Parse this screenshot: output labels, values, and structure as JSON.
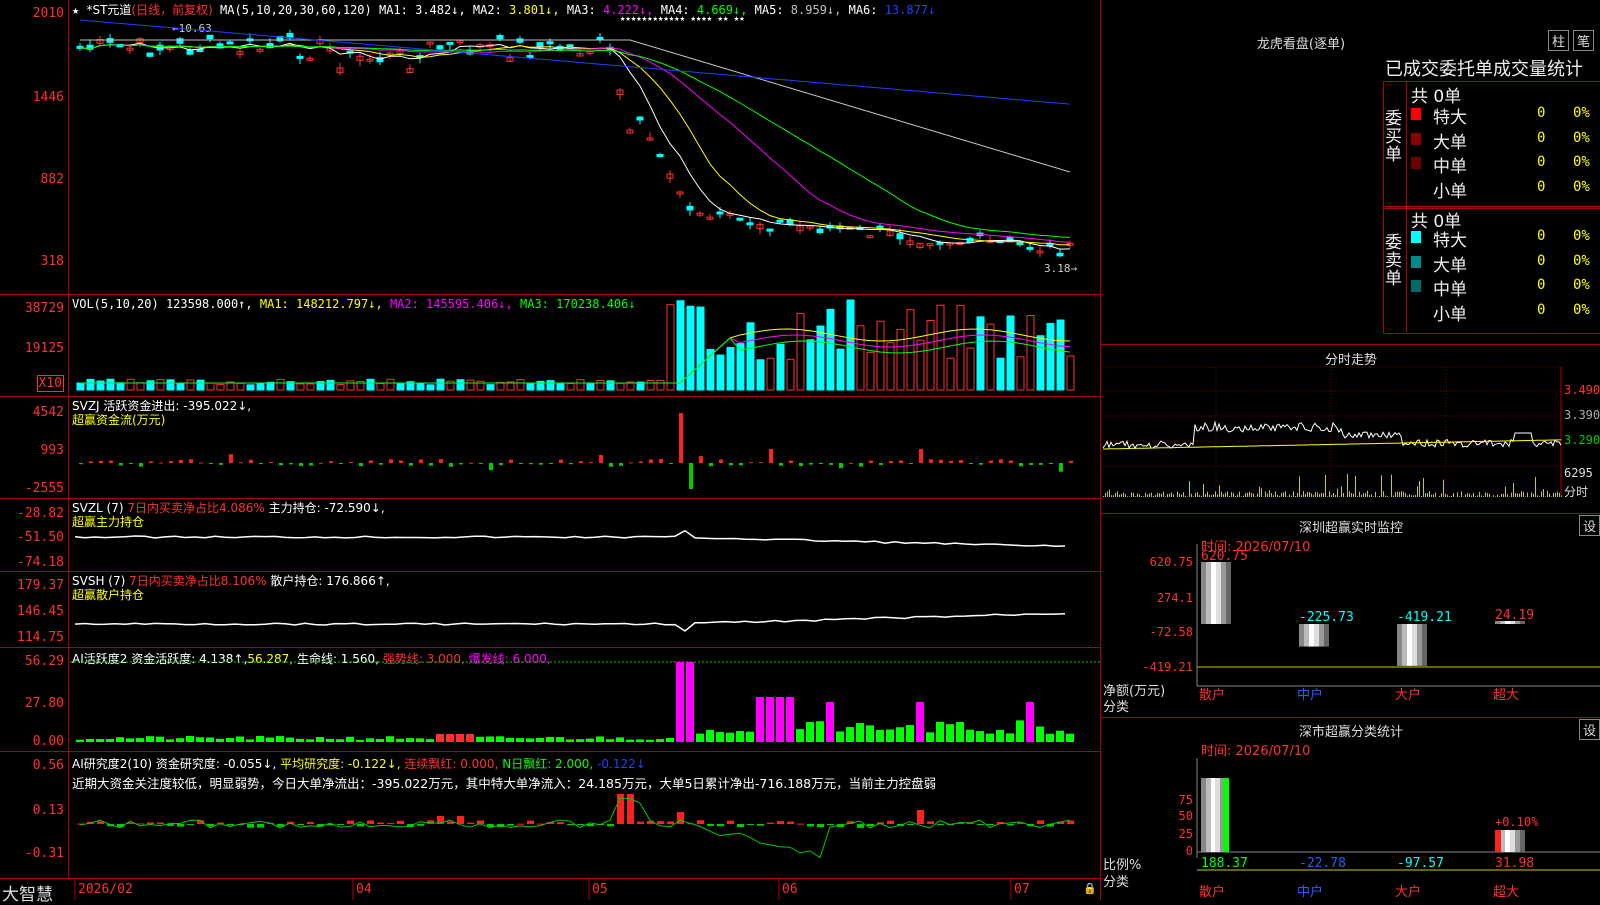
{
  "main": {
    "star_label": "★",
    "stock_name": "*ST元道",
    "period_label": "(日线，前复权)",
    "ma_label": "MA(5,10,20,30,60,120)",
    "ma_values": [
      {
        "name": "MA1:",
        "value": "3.482↓,",
        "color": "#ffffff"
      },
      {
        "name": "MA2:",
        "value": "3.801↓,",
        "color": "#ffff00"
      },
      {
        "name": "MA3:",
        "value": "4.222↓,",
        "color": "#ff00ff"
      },
      {
        "name": "MA4:",
        "value": "4.669↓,",
        "color": "#00ff00"
      },
      {
        "name": "MA5:",
        "value": "8.959↓,",
        "color": "#c0c0c0"
      },
      {
        "name": "MA6:",
        "value": "13.877↓",
        "color": "#2040ff"
      }
    ],
    "yticks": [
      "2010",
      "1446",
      "882",
      "318"
    ],
    "high_label": "←10.63",
    "low_label": "3.18→",
    "star_marks": "★★★★★★★★★★★★    ★★★★  ★★   ★★"
  },
  "vol": {
    "title": "VOL(5,10,20)",
    "value": "123598.000↑,",
    "ma1": "MA1: 148212.797↓,",
    "ma2": "MA2: 145595.406↓,",
    "ma3": "MA3: 170238.406↓",
    "yticks": [
      "38729",
      "19125"
    ],
    "scale_label": "X10"
  },
  "svzj": {
    "title": "SVZJ",
    "line1": "活跃资金进出: -395.022↓,",
    "line2": "超赢资金流(万元)",
    "yticks": [
      "4542",
      "993",
      "-2555"
    ]
  },
  "svzl": {
    "title": "SVZL (7)",
    "ratio": "7日内买卖净占比4.086%",
    "main": "主力持仓: -72.590↓,",
    "line2": "超赢主力持仓",
    "yticks": [
      "-28.82",
      "-51.50",
      "-74.18"
    ]
  },
  "svsh": {
    "title": "SVSH (7)",
    "ratio": "7日内买卖净占比8.106%",
    "main": "散户持仓: 176.866↑,",
    "line2": "超赢散户持仓",
    "yticks": [
      "179.37",
      "146.45",
      "114.75"
    ]
  },
  "ai1": {
    "title": "AI活跃度2",
    "v1": "资金活跃度: 4.138↑,",
    "v2": "56.287,",
    "v3": "生命线: 1.560,",
    "v4": "强势线: 3.000,",
    "v5": "爆发线: 6.000,",
    "yticks": [
      "56.29",
      "27.80",
      "0.00"
    ]
  },
  "ai2": {
    "title": "AI研究度2(10)",
    "v1": "资金研究度: -0.055↓,",
    "v2": "平均研究度: -0.122↓,",
    "v3": "连续飘红: 0.000,",
    "v4": "N日飘红: 2.000,",
    "v5": "-0.122↓",
    "summary": "近期大资金关注度较低，明显弱势，今日大单净流出：-395.022万元，其中特大单净流入：24.185万元，大单5日累计净出-716.188万元，当前主力控盘弱",
    "yticks": [
      "0.56",
      "0.13",
      "-0.31"
    ]
  },
  "xaxis": {
    "brand": "大智慧",
    "labels": [
      "2026/02",
      "04",
      "05",
      "06",
      "07"
    ]
  },
  "right": {
    "lhb": {
      "title": "龙虎看盘(逐单)",
      "btn1": "柱",
      "btn2": "笔",
      "subtitle": "已成交委托单成交量统计",
      "buy_group": "委买单",
      "sell_group": "委卖单",
      "buy_total": "共 0单",
      "sell_total": "共 0单",
      "buy_rows": [
        {
          "label": "特大",
          "count": "0",
          "pct": "0%",
          "color": "#ff0000"
        },
        {
          "label": "大单",
          "count": "0",
          "pct": "0%",
          "color": "#8b0000"
        },
        {
          "label": "中单",
          "count": "0",
          "pct": "0%",
          "color": "#6a0000"
        },
        {
          "label": "小单",
          "count": "0",
          "pct": "0%",
          "color": ""
        }
      ],
      "sell_rows": [
        {
          "label": "特大",
          "count": "0",
          "pct": "0%",
          "color": "#00ffff"
        },
        {
          "label": "大单",
          "count": "0",
          "pct": "0%",
          "color": "#008b8b"
        },
        {
          "label": "中单",
          "count": "0",
          "pct": "0%",
          "color": "#006a6a"
        },
        {
          "label": "小单",
          "count": "0",
          "pct": "0%",
          "color": ""
        }
      ]
    },
    "intraday": {
      "title": "分时走势",
      "yticks": [
        "3.490",
        "3.390",
        "3.290"
      ],
      "vol_tick": "6295",
      "vol_label": "分时"
    },
    "monitor": {
      "title": "深圳超赢实时监控",
      "btn": "设",
      "time": "时间: 2026/07/10",
      "yticks": [
        "620.75",
        "274.1",
        "-72.58",
        "-419.21"
      ],
      "ylabel": "净额(万元)",
      "xlabel": "分类",
      "categories": [
        "散户",
        "中户",
        "大户",
        "超大"
      ],
      "values": [
        "620.75",
        "-225.73",
        "-419.21",
        "24.19"
      ]
    },
    "classify": {
      "title": "深市超赢分类统计",
      "btn": "设",
      "time": "时间: 2026/07/10",
      "yticks": [
        "75",
        "50",
        "25",
        "0"
      ],
      "ylabel": "比例%",
      "xlabel": "分类",
      "categories": [
        "散户",
        "中户",
        "大户",
        "超大"
      ],
      "values": [
        "188.37",
        "-22.78",
        "-97.57",
        "31.98"
      ],
      "bar_label": "+0.10%"
    }
  },
  "chart_data": [
    {
      "type": "candlestick",
      "title": "*ST元道(日线，前复权)",
      "x_labels": [
        "2026/02",
        "04",
        "05",
        "06",
        "07"
      ],
      "y_ticks": [
        2010,
        1446,
        882,
        318
      ],
      "series": [
        {
          "name": "MA1",
          "last": 3.482
        },
        {
          "name": "MA2",
          "last": 3.801
        },
        {
          "name": "MA3",
          "last": 4.222
        },
        {
          "name": "MA4",
          "last": 4.669
        },
        {
          "name": "MA5",
          "last": 8.959
        },
        {
          "name": "MA6",
          "last": 13.877
        }
      ],
      "annotations": [
        "10.63",
        "3.18"
      ]
    },
    {
      "type": "bar",
      "title": "VOL(5,10,20)",
      "values": {
        "VOL": 123598.0,
        "MA1": 148212.797,
        "MA2": 145595.406,
        "MA3": 170238.406
      },
      "y_ticks": [
        38729,
        19125
      ]
    },
    {
      "type": "bar",
      "title": "深圳超赢实时监控",
      "categories": [
        "散户",
        "中户",
        "大户",
        "超大"
      ],
      "values": [
        620.75,
        -225.73,
        -419.21,
        24.19
      ],
      "ylim": [
        -419.21,
        620.75
      ]
    },
    {
      "type": "bar",
      "title": "深市超赢分类统计",
      "categories": [
        "散户",
        "中户",
        "大户",
        "超大"
      ],
      "values": [
        188.37,
        -22.78,
        -97.57,
        31.98
      ]
    }
  ]
}
